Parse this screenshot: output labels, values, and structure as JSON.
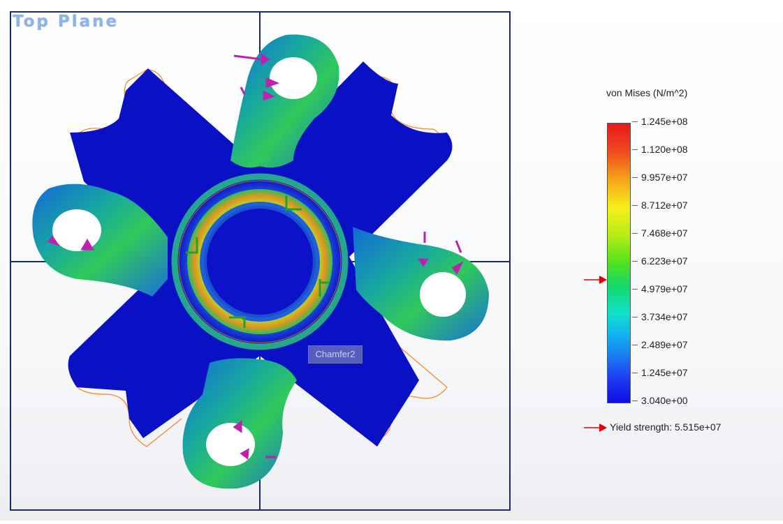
{
  "viewport": {
    "plane_label": "Top Plane",
    "feature_tag": "Chamfer2"
  },
  "legend": {
    "title": "von Mises (N/m^2)",
    "ticks": [
      "1.245e+08",
      "1.120e+08",
      "9.957e+07",
      "8.712e+07",
      "7.468e+07",
      "6.223e+07",
      "4.979e+07",
      "3.734e+07",
      "2.489e+07",
      "1.245e+07",
      "3.040e+00"
    ],
    "yield_label": "Yield strength: 5.515e+07"
  },
  "colors": {
    "sketch_line": "#1a2a66",
    "part_base": "#0a11c4",
    "outline_orange": "#f08c2c",
    "fixture_green": "#22a32a",
    "load_magenta": "#c020b0",
    "arrow_red": "#e10000"
  }
}
